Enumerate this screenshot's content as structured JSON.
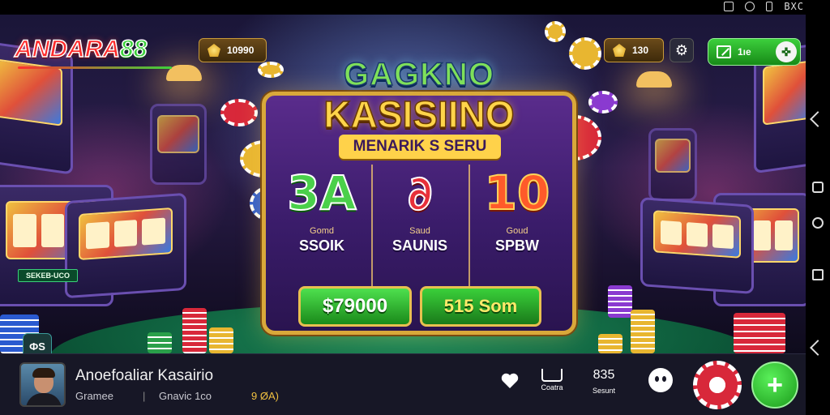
{
  "status_bar": {
    "right_text": "BXC"
  },
  "brand": {
    "logo_text": "ANDARA",
    "logo_number": "88"
  },
  "top_bar": {
    "balance": "10990",
    "score": "130",
    "settings_icon": "gear-icon",
    "green_button_text": "1ıе"
  },
  "hero": {
    "title_line1": "GAGKNO",
    "title_line2": "KASISIINO",
    "subtitle": "MENARIK S SERU",
    "columns": [
      {
        "big": "3A",
        "small": "Gomd",
        "label": "SSOIK"
      },
      {
        "big": "∂",
        "small": "Saud",
        "label": "SAUNIS"
      },
      {
        "big": "10",
        "small": "Goud",
        "label": "SPBW"
      }
    ],
    "amount_button": "$79000",
    "spin_button": "515 Som"
  },
  "scene": {
    "badge_text": "SEKEB-UCO",
    "corner_button": "ФS"
  },
  "bottom_bar": {
    "game_title": "Anoefoaliar Kasairio",
    "category": "Gramee",
    "genre": "Gnavic 1co",
    "rating": "9 ØA)",
    "actions": [
      {
        "icon": "heart-icon",
        "label": ""
      },
      {
        "icon": "cart-icon",
        "label": "Coatra"
      },
      {
        "icon": "stats-icon",
        "text": "835",
        "label": "Sesunt"
      },
      {
        "icon": "face-icon",
        "label": ""
      }
    ]
  },
  "colors": {
    "accent_gold": "#d9a83a",
    "accent_green": "#2aa04a",
    "accent_red": "#d8283a",
    "hero_purple": "#5a2c8c"
  }
}
